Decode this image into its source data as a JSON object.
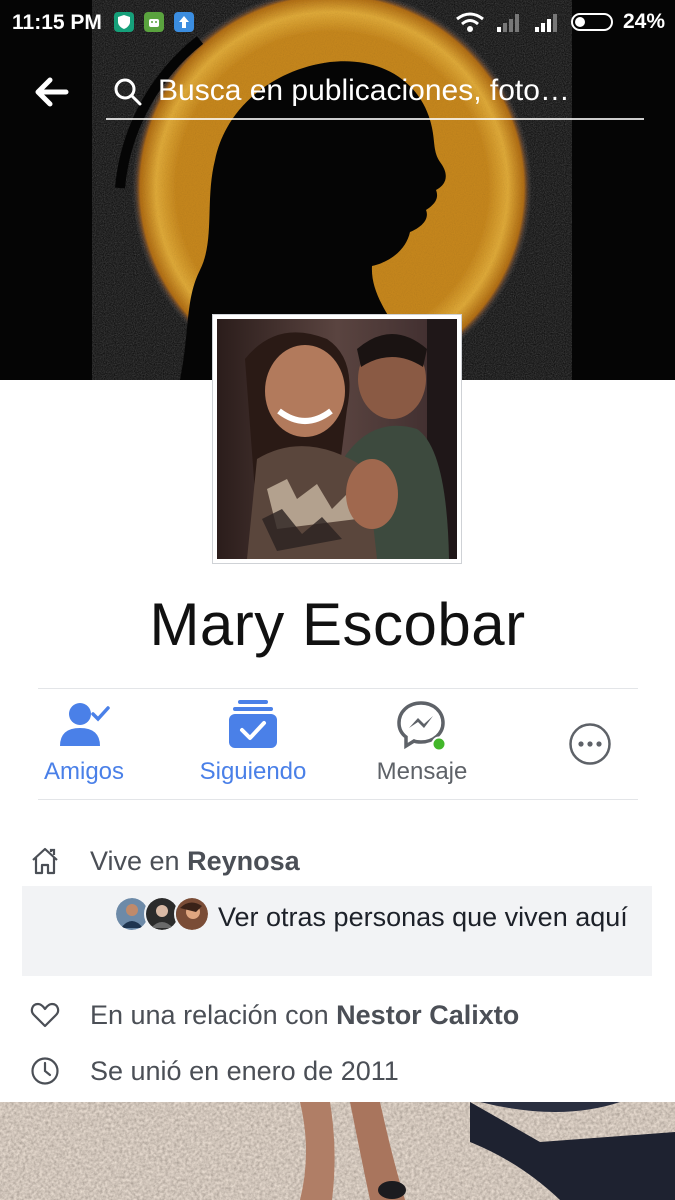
{
  "status_bar": {
    "time": "11:15 PM",
    "battery": "24%",
    "icons": [
      "vpn-shield-icon",
      "android-icon",
      "upload-icon",
      "wifi-icon",
      "signal-icon",
      "signal-icon",
      "battery-icon"
    ]
  },
  "top_bar": {
    "back_icon": "arrow-left-icon",
    "search_placeholder": "Busca en publicaciones, foto…"
  },
  "profile": {
    "name": "Mary Escobar"
  },
  "actions": [
    {
      "label": "Amigos",
      "icon": "friends-check-icon",
      "active": true
    },
    {
      "label": "Siguiendo",
      "icon": "following-inbox-icon",
      "active": true
    },
    {
      "label": "Mensaje",
      "icon": "messenger-icon",
      "active": false
    },
    {
      "label": "",
      "icon": "more-icon",
      "active": false
    }
  ],
  "info": {
    "lives_prefix": "Vive en ",
    "lives_city": "Reynosa",
    "others_text": "Ver otras personas que viven aquí",
    "relationship_prefix": "En una relación con ",
    "relationship_name": "Nestor Calixto",
    "joined": "Se unió en enero de 2011"
  },
  "colors": {
    "accent": "#4267b2",
    "action_blue": "#4a80e8",
    "muted_gray": "#5e6268",
    "online_green": "#42b72a"
  }
}
